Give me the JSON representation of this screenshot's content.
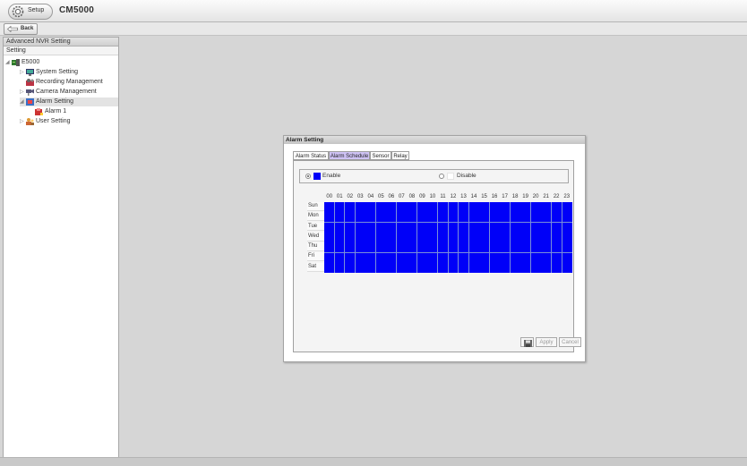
{
  "titlebar": {
    "setup_label": "Setup",
    "app_title": "CM5000"
  },
  "navbar": {
    "back_label": "Back"
  },
  "sidebar": {
    "header": "Advanced NVR Setting",
    "section": "Setting",
    "tree": [
      {
        "label": "E5000",
        "icon": "server-icon"
      },
      {
        "label": "System Setting",
        "icon": "system-icon"
      },
      {
        "label": "Recording Management",
        "icon": "recording-icon"
      },
      {
        "label": "Camera Management",
        "icon": "camera-icon"
      },
      {
        "label": "Alarm Setting",
        "icon": "alarm-icon"
      },
      {
        "label": "Alarm 1",
        "icon": "alarm-item-icon"
      },
      {
        "label": "User Setting",
        "icon": "user-icon"
      }
    ]
  },
  "dialog": {
    "title": "Alarm Setting",
    "tabs": [
      "Alarm Status",
      "Alarm Schedule",
      "Sensor",
      "Relay"
    ],
    "active_tab": "Alarm Schedule",
    "schedule": {
      "enable_label": "Enable",
      "disable_label": "Disable",
      "selected": "Enable",
      "hours": [
        "00",
        "01",
        "02",
        "03",
        "04",
        "05",
        "06",
        "07",
        "08",
        "09",
        "10",
        "11",
        "12",
        "13",
        "14",
        "15",
        "16",
        "17",
        "18",
        "19",
        "20",
        "21",
        "22",
        "23"
      ],
      "days": [
        "Sun",
        "Mon",
        "Tue",
        "Wed",
        "Thu",
        "Fri",
        "Sat"
      ],
      "all_enabled": true
    },
    "buttons": {
      "apply": "Apply",
      "cancel": "Cancel"
    }
  },
  "colors": {
    "enabled": "#0000f8",
    "disabled": "#ffffff",
    "active_tab": "#cfc3f5"
  }
}
